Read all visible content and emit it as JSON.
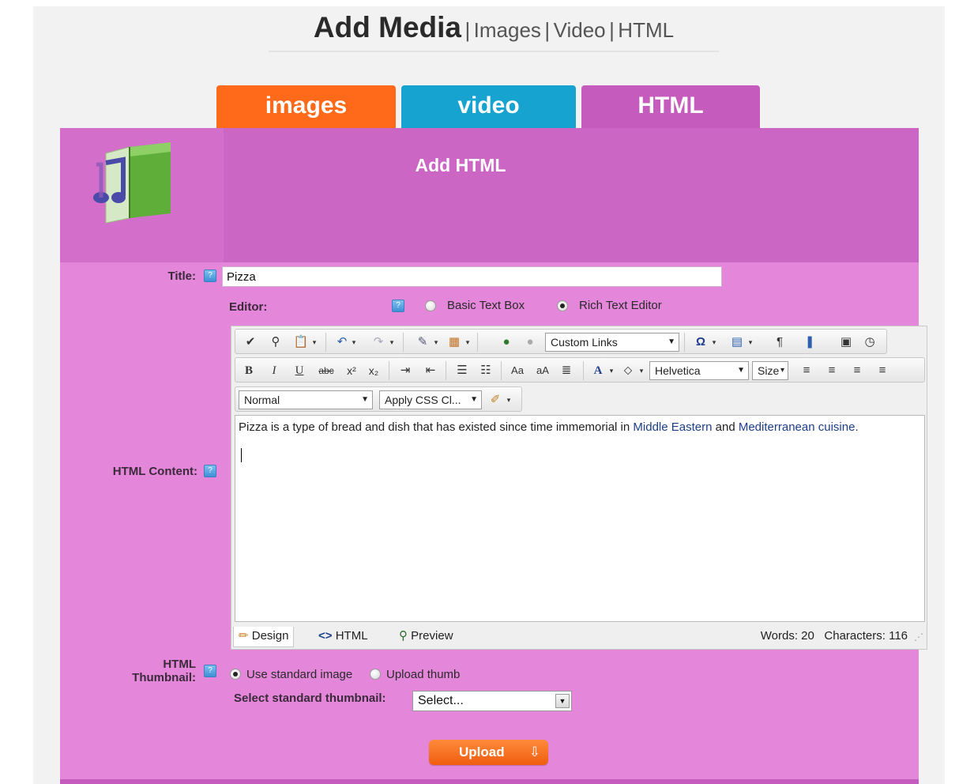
{
  "header": {
    "title": "Add Media",
    "separator": "|",
    "links": [
      "Images",
      "Video",
      "HTML"
    ]
  },
  "tabs": [
    {
      "label": "images",
      "color": "#ff6a1a"
    },
    {
      "label": "video",
      "color": "#17a3cf"
    },
    {
      "label": "HTML",
      "color": "#c45bbd",
      "active": true
    }
  ],
  "panel": {
    "heading": "Add HTML",
    "icon": "music-book-icon"
  },
  "form": {
    "title_label": "Title:",
    "title_value": "Pizza",
    "editor_label": "Editor:",
    "editor_options": [
      "Basic Text Box",
      "Rich Text Editor"
    ],
    "editor_selected": "Rich Text Editor",
    "content_label": "HTML Content:",
    "thumbnail_label_1": "HTML",
    "thumbnail_label_2": "Thumbnail:",
    "thumb_options": [
      "Use standard image",
      "Upload thumb"
    ],
    "thumb_selected": "Use standard image",
    "select_thumb_label": "Select standard thumbnail:",
    "select_thumb_value": "Select...",
    "upload_label": "Upload"
  },
  "editor": {
    "custom_links": "Custom Links",
    "font_name": "Helvetica",
    "font_size": "Size",
    "paragraph_format": "Normal",
    "css_class": "Apply CSS Cl...",
    "content": {
      "text_before": "Pizza is a type of bread and dish that has existed since time immemorial in ",
      "link1": "Middle Eastern",
      "text_mid": " and ",
      "link2": "Mediterranean cuisine",
      "text_after": "."
    },
    "modes": [
      "Design",
      "HTML",
      "Preview"
    ],
    "active_mode": "Design",
    "words": "Words: 20",
    "characters": "Characters: 116"
  }
}
